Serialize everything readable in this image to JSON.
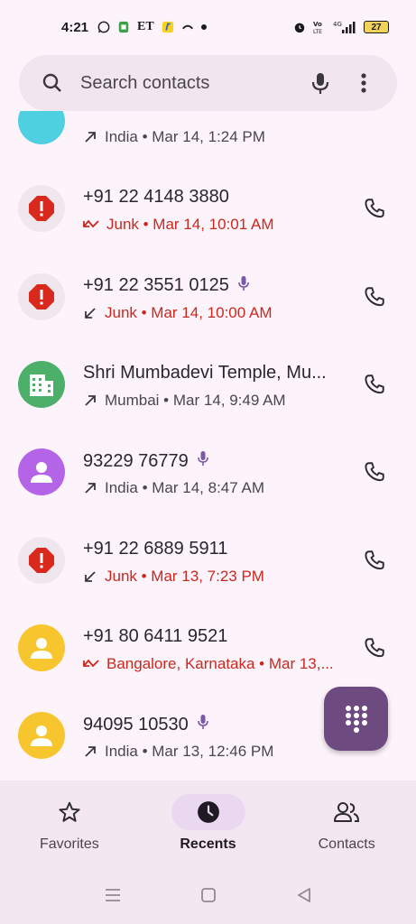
{
  "status": {
    "time": "4:21",
    "notif_icons": [
      "whatsapp-icon",
      "shield-app-icon",
      "et-icon",
      "flipkart-icon",
      "missed-call-icon",
      "dot-icon"
    ],
    "et_text": "ET",
    "right_icons": [
      "alarm-icon",
      "volte-icon",
      "signal-4g-icon"
    ],
    "battery": "27"
  },
  "search": {
    "placeholder": "Search contacts"
  },
  "calls": [
    {
      "name": "",
      "sub": "India • Mar 14, 1:24 PM",
      "type": "outgoing",
      "junk": false,
      "voicemail": false,
      "avatar": "partial",
      "color": "#4fd0e0"
    },
    {
      "name": "+91 22 4148 3880",
      "sub": "Junk • Mar 14, 10:01 AM",
      "type": "missed",
      "junk": true,
      "voicemail": false,
      "avatar": "spam",
      "color": "#f0e6ee"
    },
    {
      "name": "+91 22 3551 0125",
      "sub": "Junk • Mar 14, 10:00 AM",
      "type": "incoming",
      "junk": true,
      "voicemail": true,
      "avatar": "spam",
      "color": "#f0e6ee"
    },
    {
      "name": "Shri Mumbadevi Temple, Mu...",
      "sub": "Mumbai • Mar 14, 9:49 AM",
      "type": "outgoing",
      "junk": false,
      "voicemail": false,
      "avatar": "business",
      "color": "#4caf6a"
    },
    {
      "name": "93229 76779",
      "sub": "India • Mar 14, 8:47 AM",
      "type": "outgoing",
      "junk": false,
      "voicemail": true,
      "avatar": "person",
      "color": "#b464e6"
    },
    {
      "name": "+91 22 6889 5911",
      "sub": "Junk • Mar 13, 7:23 PM",
      "type": "incoming",
      "junk": true,
      "voicemail": false,
      "avatar": "spam",
      "color": "#f0e6ee"
    },
    {
      "name": "+91 80 6411 9521",
      "sub": "Bangalore, Karnataka • Mar 13,...",
      "type": "missed",
      "junk": true,
      "voicemail": false,
      "avatar": "person",
      "color": "#f7c62f"
    },
    {
      "name": "94095 10530",
      "sub": "India • Mar 13, 12:46 PM",
      "type": "outgoing",
      "junk": false,
      "voicemail": true,
      "avatar": "person",
      "color": "#f7c62f"
    }
  ],
  "fab": {
    "icon": "dialpad-icon"
  },
  "nav": [
    {
      "label": "Favorites",
      "icon": "star-icon",
      "active": false
    },
    {
      "label": "Recents",
      "icon": "clock-icon",
      "active": true
    },
    {
      "label": "Contacts",
      "icon": "people-icon",
      "active": false
    }
  ],
  "system_nav": [
    "menu-icon",
    "home-icon",
    "back-icon"
  ]
}
